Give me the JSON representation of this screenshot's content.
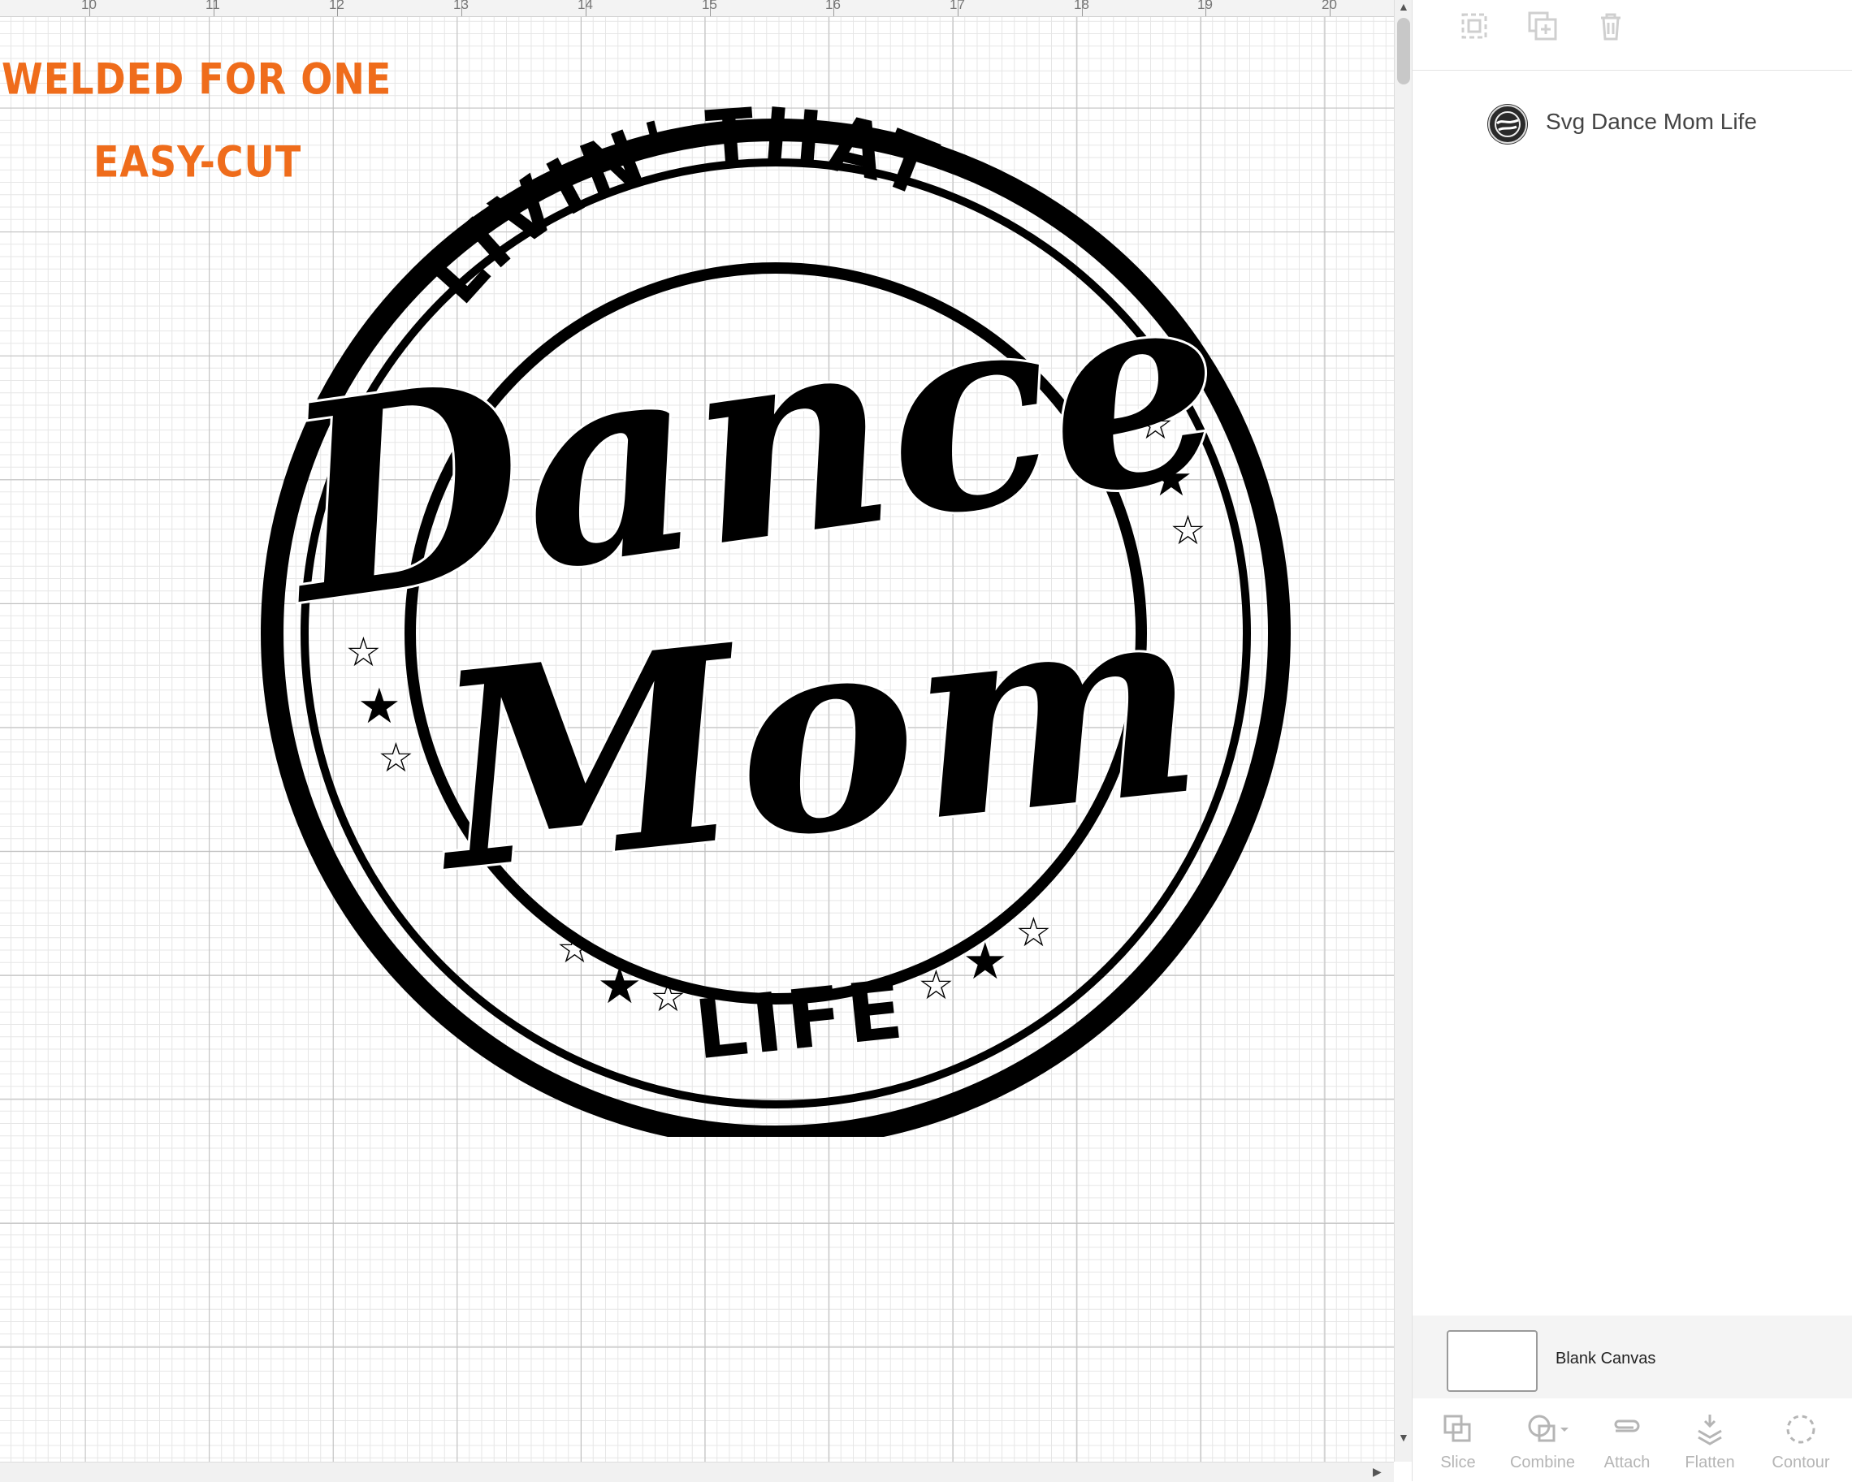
{
  "ruler": {
    "labels": [
      "10",
      "11",
      "12",
      "13",
      "14",
      "15",
      "16",
      "17",
      "18",
      "19",
      "20"
    ]
  },
  "annotations": {
    "line1": "WELDED FOR ONE",
    "line2": "EASY-CUT"
  },
  "design": {
    "top_arc_text": "LIVIN' THAT",
    "script_line1": "Dance",
    "script_line2": "Mom",
    "bottom_text": "LIFE",
    "fill_color": "#000000"
  },
  "layers_panel": {
    "layer_name": "Svg Dance Mom Life"
  },
  "canvas_section": {
    "label": "Blank Canvas"
  },
  "bottom_toolbar": {
    "items": [
      {
        "label": "Slice",
        "icon": "slice-icon"
      },
      {
        "label": "Combine",
        "icon": "combine-icon"
      },
      {
        "label": "Attach",
        "icon": "attach-icon"
      },
      {
        "label": "Flatten",
        "icon": "flatten-icon"
      },
      {
        "label": "Contour",
        "icon": "contour-icon"
      }
    ]
  },
  "colors": {
    "annotation_orange": "#ef6c1b",
    "disabled_gray": "#b5b5b5"
  }
}
